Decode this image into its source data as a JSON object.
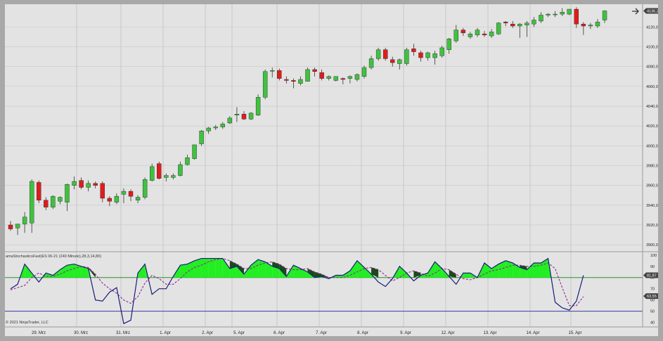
{
  "colors": {
    "up_candle": "#3fc23f",
    "down_candle": "#e01c1c",
    "wick": "#333333",
    "stoch_k_line": "#1c1c7a",
    "stoch_d_line": "#8e2a8e",
    "overbought_fill": "#22ee22",
    "overbought_dark_fill": "#1a4a1a",
    "overbought_line": "#2f8f2f",
    "oversold_line": "#3a3aa0",
    "grid": "#c7c7c7",
    "last_price_tag": "#444444"
  },
  "toolbar": {
    "nav_icon": "arrow-right-icon"
  },
  "price_panel": {
    "axis_labels": [
      "4120,00",
      "4100,00",
      "4080,00",
      "4060,00",
      "4040,00",
      "4020,00",
      "4000,00",
      "3980,00",
      "3960,00",
      "3940,00",
      "3920,00",
      "3900,00"
    ],
    "last_price_label": "4136,25",
    "last_price": 4136.25
  },
  "indicator_panel": {
    "title": "amaStochasticsFast(ES 06-21 (240 Minute),28,3,14,80)",
    "axis_labels": [
      "100",
      "90",
      "80",
      "70",
      "60",
      "50",
      "40"
    ],
    "upper_tag": "81,87",
    "lower_tag": "63,55",
    "upper_level": 80,
    "lower_level": 50
  },
  "time_axis": {
    "labels": [
      "29. Mrz",
      "30. Mrz",
      "31. Mrz",
      "1. Apr",
      "2. Apr",
      "5. Apr",
      "6. Apr",
      "7. Apr",
      "8. Apr",
      "9. Apr",
      "12. Apr",
      "13. Apr",
      "14. Apr",
      "15. Apr"
    ]
  },
  "copyright": "© 2021 NinjaTrader, LLC",
  "chart_data": [
    {
      "type": "candlestick",
      "title": "",
      "xlabel": "",
      "ylabel": "",
      "ylim": [
        3893,
        4143
      ],
      "grid": true,
      "candles": [
        [
          3920,
          3924,
          3914,
          3916
        ],
        [
          3917,
          3921,
          3910,
          3921
        ],
        [
          3921,
          3933,
          3912,
          3928
        ],
        [
          3922,
          3966,
          3912,
          3964
        ],
        [
          3963,
          3965,
          3942,
          3945
        ],
        [
          3945,
          3948,
          3935,
          3938
        ],
        [
          3938,
          3950,
          3936,
          3949
        ],
        [
          3944,
          3949,
          3941,
          3948
        ],
        [
          3943,
          3962,
          3934,
          3961
        ],
        [
          3960,
          3969,
          3956,
          3964
        ],
        [
          3965,
          3968,
          3956,
          3958
        ],
        [
          3958,
          3965,
          3954,
          3962
        ],
        [
          3962,
          3964,
          3957,
          3960
        ],
        [
          3962,
          3964,
          3943,
          3947
        ],
        [
          3947,
          3949,
          3939,
          3944
        ],
        [
          3943,
          3952,
          3941,
          3949
        ],
        [
          3951,
          3957,
          3942,
          3954
        ],
        [
          3954,
          3956,
          3944,
          3949
        ],
        [
          3945,
          3950,
          3942,
          3948
        ],
        [
          3948,
          3968,
          3946,
          3966
        ],
        [
          3965,
          3982,
          3964,
          3979
        ],
        [
          3982,
          3984,
          3966,
          3967
        ],
        [
          3968,
          3972,
          3964,
          3970
        ],
        [
          3968,
          3972,
          3966,
          3970
        ],
        [
          3970,
          3984,
          3969,
          3981
        ],
        [
          3981,
          3991,
          3980,
          3988
        ],
        [
          3987,
          4001,
          3986,
          4001
        ],
        [
          4002,
          4016,
          4000,
          4015
        ],
        [
          4015,
          4019,
          4012,
          4018
        ],
        [
          4018,
          4021,
          4016,
          4019
        ],
        [
          4019,
          4024,
          4017,
          4022
        ],
        [
          4023,
          4030,
          4022,
          4028
        ],
        [
          4031,
          4039,
          4024,
          4032
        ],
        [
          4032,
          4035,
          4026,
          4027
        ],
        [
          4027,
          4034,
          4026,
          4033
        ],
        [
          4031,
          4052,
          4030,
          4049
        ],
        [
          4049,
          4077,
          4047,
          4075
        ],
        [
          4076,
          4079,
          4069,
          4076
        ],
        [
          4076,
          4078,
          4066,
          4068
        ],
        [
          4067,
          4070,
          4063,
          4066
        ],
        [
          4066,
          4068,
          4058,
          4065
        ],
        [
          4063,
          4070,
          4061,
          4067
        ],
        [
          4065,
          4079,
          4065,
          4077
        ],
        [
          4077,
          4079,
          4070,
          4075
        ],
        [
          4074,
          4077,
          4066,
          4068
        ],
        [
          4068,
          4071,
          4066,
          4070
        ],
        [
          4066,
          4070,
          4065,
          4070
        ],
        [
          4068,
          4069,
          4062,
          4067
        ],
        [
          4068,
          4071,
          4063,
          4070
        ],
        [
          4067,
          4073,
          4065,
          4072
        ],
        [
          4070,
          4081,
          4068,
          4079
        ],
        [
          4079,
          4091,
          4077,
          4088
        ],
        [
          4088,
          4099,
          4086,
          4097
        ],
        [
          4097,
          4099,
          4086,
          4088
        ],
        [
          4087,
          4090,
          4080,
          4084
        ],
        [
          4083,
          4088,
          4077,
          4087
        ],
        [
          4083,
          4099,
          4081,
          4097
        ],
        [
          4098,
          4103,
          4091,
          4095
        ],
        [
          4094,
          4096,
          4085,
          4089
        ],
        [
          4089,
          4095,
          4086,
          4094
        ],
        [
          4089,
          4096,
          4082,
          4093
        ],
        [
          4091,
          4101,
          4089,
          4099
        ],
        [
          4097,
          4109,
          4093,
          4108
        ],
        [
          4106,
          4122,
          4104,
          4117
        ],
        [
          4117,
          4119,
          4111,
          4114
        ],
        [
          4110,
          4115,
          4108,
          4113
        ],
        [
          4112,
          4119,
          4110,
          4117
        ],
        [
          4113,
          4116,
          4110,
          4112
        ],
        [
          4111,
          4118,
          4109,
          4115
        ],
        [
          4113,
          4125,
          4112,
          4124
        ],
        [
          4125,
          4126,
          4121,
          4124
        ],
        [
          4123,
          4126,
          4119,
          4121
        ],
        [
          4121,
          4124,
          4109,
          4123
        ],
        [
          4122,
          4126,
          4110,
          4124
        ],
        [
          4123,
          4130,
          4120,
          4127
        ],
        [
          4126,
          4135,
          4124,
          4132
        ],
        [
          4132,
          4134,
          4130,
          4133
        ],
        [
          4133,
          4136,
          4130,
          4133
        ],
        [
          4133,
          4139,
          4131,
          4135
        ],
        [
          4133,
          4138,
          4132,
          4138
        ],
        [
          4138,
          4140,
          4119,
          4123
        ],
        [
          4123,
          4125,
          4112,
          4121
        ],
        [
          4121,
          4124,
          4118,
          4122
        ],
        [
          4121,
          4128,
          4119,
          4125
        ],
        [
          4127,
          4137,
          4124,
          4136.25
        ]
      ]
    },
    {
      "type": "line",
      "title": "amaStochasticsFast(ES 06-21 (240 Minute),28,3,14,80)",
      "xlabel": "",
      "ylabel": "",
      "ylim": [
        36,
        103
      ],
      "grid": true,
      "series": [
        {
          "values": [
            70,
            74,
            92,
            84,
            76,
            84,
            82,
            87,
            91,
            92,
            90,
            88,
            60,
            59,
            67,
            71,
            39,
            42,
            84,
            92,
            65,
            70,
            70,
            81,
            91,
            92,
            95,
            97,
            97,
            97,
            97,
            88,
            90,
            83,
            91,
            96,
            94,
            90,
            88,
            81,
            91,
            88,
            85,
            80,
            81,
            79,
            82,
            82,
            86,
            95,
            89,
            83,
            76,
            72,
            79,
            90,
            84,
            77,
            82,
            84,
            94,
            88,
            81,
            74,
            84,
            84,
            80,
            93,
            88,
            92,
            95,
            93,
            89,
            87,
            93,
            93,
            97,
            58,
            53,
            51,
            59,
            82
          ]
        },
        {
          "values": [
            69,
            71,
            73,
            80,
            84,
            81,
            81,
            83,
            86,
            88,
            90,
            89,
            83,
            75,
            70,
            66,
            60,
            57,
            63,
            75,
            82,
            79,
            74,
            74,
            79,
            85,
            89,
            91,
            94,
            96,
            97,
            95,
            92,
            88,
            88,
            91,
            93,
            94,
            92,
            88,
            87,
            87,
            88,
            85,
            83,
            80,
            80,
            80,
            82,
            85,
            88,
            89,
            87,
            82,
            77,
            80,
            84,
            86,
            84,
            81,
            84,
            88,
            87,
            83,
            79,
            78,
            80,
            83,
            86,
            87,
            89,
            91,
            91,
            90,
            90,
            91,
            93,
            88,
            71,
            55,
            55,
            63
          ]
        }
      ]
    }
  ]
}
